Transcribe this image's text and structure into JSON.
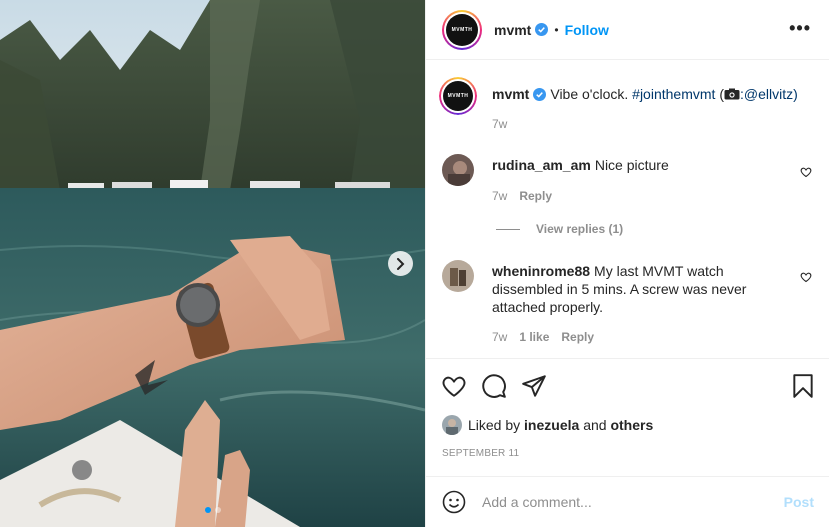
{
  "post": {
    "username": "mvmt",
    "follow_label": "Follow",
    "separator": "•",
    "avatar_text": "MVMTH",
    "more_label": "•••",
    "caption": {
      "username": "mvmt",
      "text": "Vibe o'clock.",
      "hashtag": "#jointhemvmt",
      "credit_open": "(",
      "credit_user": ":@ellvitz)",
      "time": "7w"
    },
    "comments": [
      {
        "username": "rudina_am_am",
        "text": "Nice picture",
        "time": "7w",
        "reply_label": "Reply",
        "view_replies": "View replies (1)"
      },
      {
        "username": "wheninrome88",
        "text": "My last MVMT watch dissembled in 5 mins. A screw was never attached properly.",
        "time": "7w",
        "likes": "1 like",
        "reply_label": "Reply"
      }
    ],
    "liked_by": {
      "prefix": "Liked by",
      "user": "inezuela",
      "joiner": "and",
      "others": "others"
    },
    "date": "SEPTEMBER 11",
    "add_comment_placeholder": "Add a comment...",
    "post_label": "Post",
    "carousel": {
      "count": 2,
      "active": 0
    }
  },
  "icons": {
    "verified": "verified-badge-icon",
    "heart": "heart-icon",
    "comment": "comment-icon",
    "share": "share-icon",
    "save": "bookmark-icon",
    "emoji": "emoji-icon",
    "next": "chevron-right-icon",
    "more": "more-options-icon"
  },
  "colors": {
    "accent": "#0095f6",
    "text": "#262626",
    "muted": "#8e8e8e",
    "hashtag": "#00376b",
    "post_disabled": "#b2dffc"
  }
}
